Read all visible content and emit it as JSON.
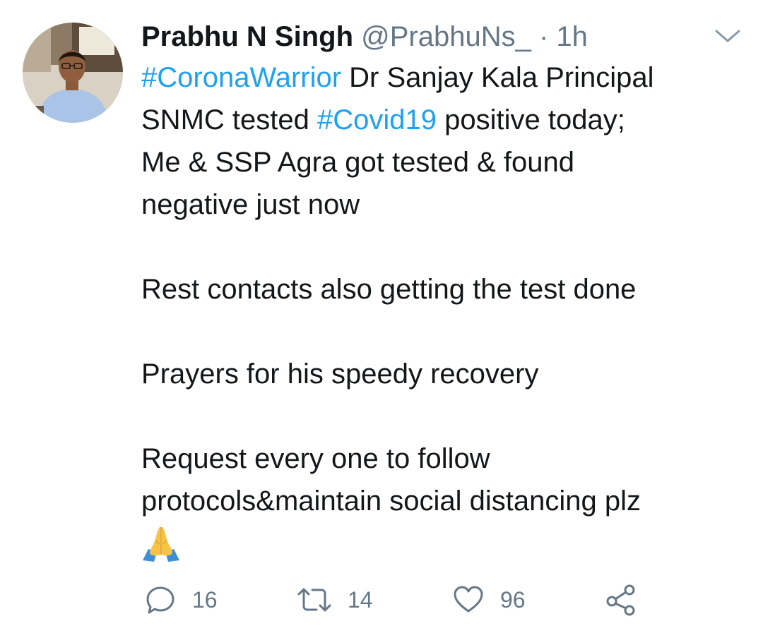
{
  "tweet": {
    "display_name": "Prabhu N Singh",
    "handle": "@PrabhuNs_",
    "separator": " · ",
    "time": "1h",
    "lines": {
      "l1_hashtag": "#CoronaWarrior",
      "l1_text": " Dr Sanjay Kala Principal",
      "l2_text_a": "SNMC tested ",
      "l2_hashtag": "#Covid19",
      "l2_text_b": " positive today;",
      "l3_text": "Me & SSP Agra got tested & found",
      "l4_text": "negative just now",
      "l5_text": "Rest contacts also getting the test done",
      "l6_text": "Prayers for his speedy recovery",
      "l7_text": "Request every one to follow",
      "l8_text": "protocols&maintain social distancing plz"
    },
    "emoji": "folded-hands-emoji"
  },
  "actions": {
    "replies": "16",
    "retweets": "14",
    "likes": "96"
  },
  "colors": {
    "text": "#14171a",
    "secondary": "#657786",
    "hashtag": "#1da1f2"
  },
  "icons": {
    "reply": "reply-icon",
    "retweet": "retweet-icon",
    "like": "heart-icon",
    "share": "share-icon",
    "menu": "chevron-down-icon"
  }
}
